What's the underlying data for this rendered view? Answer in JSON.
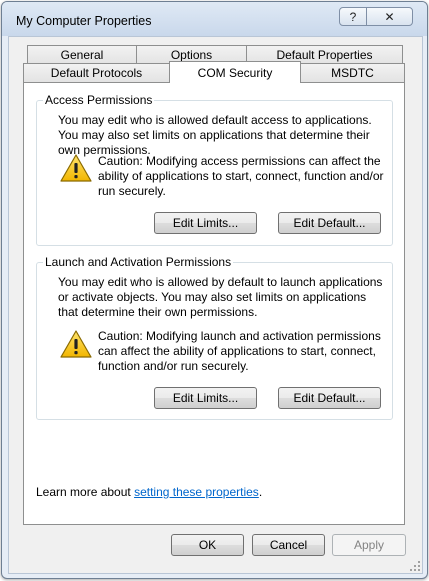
{
  "window": {
    "title": "My Computer Properties",
    "help_label": "?",
    "close_label": "✕"
  },
  "tabs": {
    "row1": [
      "General",
      "Options",
      "Default Properties"
    ],
    "row2": [
      "Default Protocols",
      "COM Security",
      "MSDTC"
    ],
    "active": "COM Security"
  },
  "access": {
    "legend": "Access Permissions",
    "description": "You may edit who is allowed default access to applications. You may also set limits on applications that determine their own permissions.",
    "caution": "Caution: Modifying access permissions can affect the ability of applications to start, connect, function and/or run securely.",
    "edit_limits": "Edit Limits...",
    "edit_default": "Edit Default..."
  },
  "launch": {
    "legend": "Launch and Activation Permissions",
    "description": "You may edit who is allowed by default to launch applications or activate objects. You may also set limits on applications that determine their own permissions.",
    "caution": "Caution: Modifying launch and activation permissions can affect the ability of applications to start, connect, function and/or run securely.",
    "edit_limits": "Edit Limits...",
    "edit_default": "Edit Default..."
  },
  "learn_more": {
    "prefix": "Learn more about ",
    "link": "setting these properties",
    "suffix": "."
  },
  "footer": {
    "ok": "OK",
    "cancel": "Cancel",
    "apply": "Apply"
  }
}
